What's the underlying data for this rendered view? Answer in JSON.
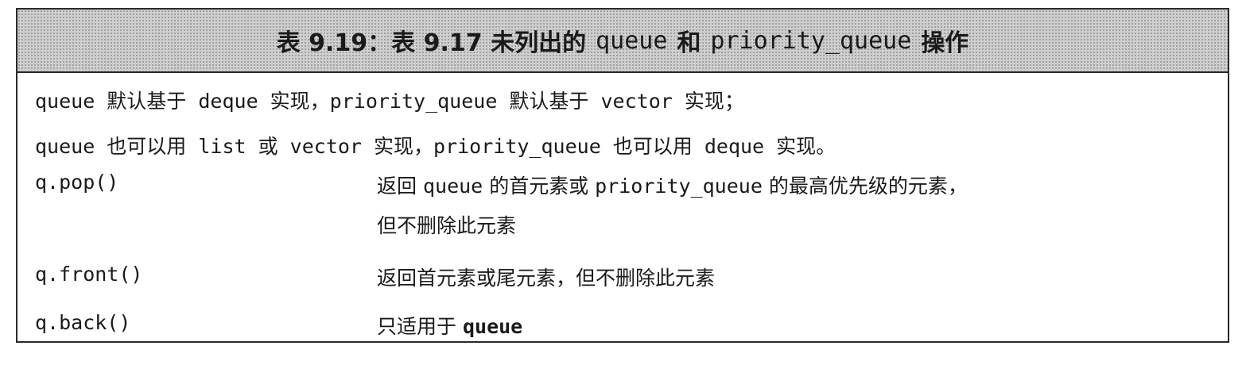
{
  "caption": {
    "prefix": "表 9.19：表 9.17 未列出的",
    "term1": "queue",
    "conj": "和",
    "term2": "priority_queue",
    "suffix": "操作"
  },
  "notes": [
    "queue 默认基于 deque 实现，priority_queue 默认基于 vector 实现；",
    "queue 也可以用 list 或 vector 实现，priority_queue 也可以用 deque 实现。"
  ],
  "rows": [
    {
      "code": "q.pop()",
      "desc_a": "返回",
      "desc_term1": "queue",
      "desc_b": "的首元素或",
      "desc_term2": "priority_queue",
      "desc_c": "的最高优先级的元素，",
      "desc_line2": "但不删除此元素"
    },
    {
      "code": "q.front()",
      "desc": "返回首元素或尾元素，但不删除此元素"
    },
    {
      "code": "q.back()",
      "desc_prefix": "只适用于",
      "desc_bold": "queue"
    }
  ]
}
